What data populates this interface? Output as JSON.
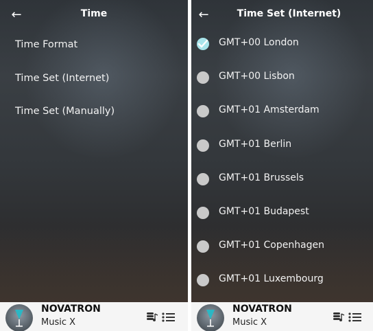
{
  "left": {
    "title": "Time",
    "back_icon": "arrow-left-icon",
    "items": [
      {
        "label": "Time Format"
      },
      {
        "label": "Time Set (Internet)"
      },
      {
        "label": "Time Set (Manually)"
      }
    ],
    "player": {
      "brand": "NOVATRON",
      "subtitle": "Music X"
    }
  },
  "right": {
    "title": "Time Set (Internet)",
    "back_icon": "arrow-left-icon",
    "options": [
      {
        "label": "GMT+00 London",
        "checked": true
      },
      {
        "label": "GMT+00 Lisbon",
        "checked": false
      },
      {
        "label": "GMT+01 Amsterdam",
        "checked": false
      },
      {
        "label": "GMT+01 Berlin",
        "checked": false
      },
      {
        "label": "GMT+01 Brussels",
        "checked": false
      },
      {
        "label": "GMT+01 Budapest",
        "checked": false
      },
      {
        "label": "GMT+01 Copenhagen",
        "checked": false
      },
      {
        "label": "GMT+01 Luxembourg",
        "checked": false
      }
    ],
    "player": {
      "brand": "NOVATRON",
      "subtitle": "Music X"
    }
  },
  "colors": {
    "checked": "#a8e4ea",
    "unchecked": "#c9c9c9",
    "player_bg": "#f5f5f5"
  }
}
